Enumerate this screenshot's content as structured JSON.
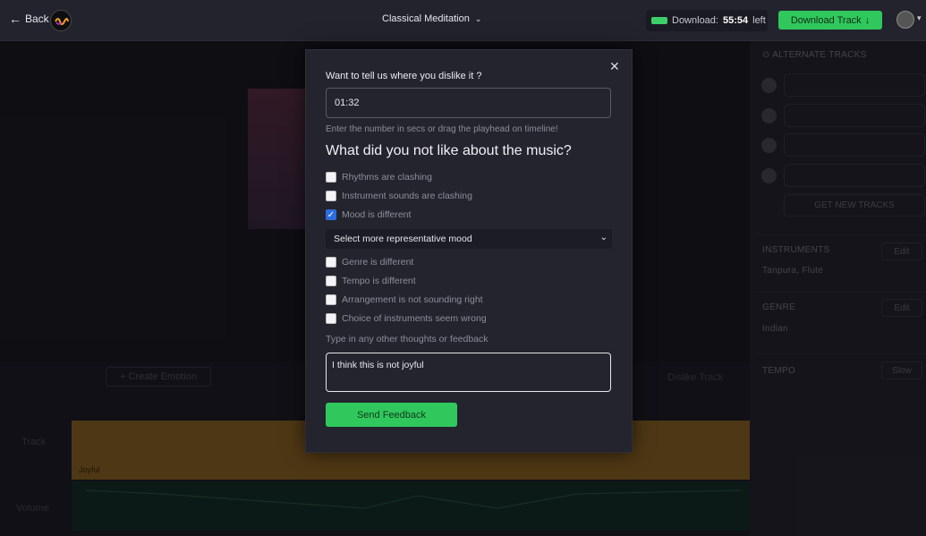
{
  "header": {
    "back_label": "Back",
    "track_title": "Classical Meditation",
    "download_label": "Download:",
    "download_time": "55:54",
    "download_suffix": "left",
    "download_button": "Download Track"
  },
  "sidebar": {
    "alternate_title": "ALTERNATE TRACKS",
    "get_new": "GET NEW TRACKS",
    "instruments_title": "INSTRUMENTS",
    "instruments_value": "Tanpura, Flute",
    "genre_title": "GENRE",
    "genre_value": "Indian",
    "tempo_title": "TEMPO",
    "tempo_value": "Slow",
    "edit_label": "Edit"
  },
  "bottom": {
    "create_emotion": "Create Emotion",
    "dislike_track": "Dislike Track",
    "track_label": "Track",
    "volume_label": "Volume",
    "mood_tag": "Joyful"
  },
  "modal": {
    "question1": "Want to tell us where you dislike it ?",
    "time_value": "01:32",
    "hint": "Enter the number in secs or drag the playhead on timeline!",
    "question2": "What did you not like about the music?",
    "options": [
      {
        "label": "Rhythms are clashing",
        "checked": false
      },
      {
        "label": "Instrument sounds are clashing",
        "checked": false
      },
      {
        "label": "Mood is different",
        "checked": true
      },
      {
        "label": "Genre is different",
        "checked": false
      },
      {
        "label": "Tempo is different",
        "checked": false
      },
      {
        "label": "Arrangement is not sounding right",
        "checked": false
      },
      {
        "label": "Choice of instruments seem wrong",
        "checked": false
      }
    ],
    "mood_select": "Select more representative mood",
    "other_label": "Type in any other thoughts or feedback",
    "feedback_value": "I think this is not joyful",
    "send_button": "Send Feedback"
  },
  "colors": {
    "accent_green": "#30c85c",
    "timeline_orange": "#8e6426",
    "checkbox_blue": "#2d6cdf"
  }
}
